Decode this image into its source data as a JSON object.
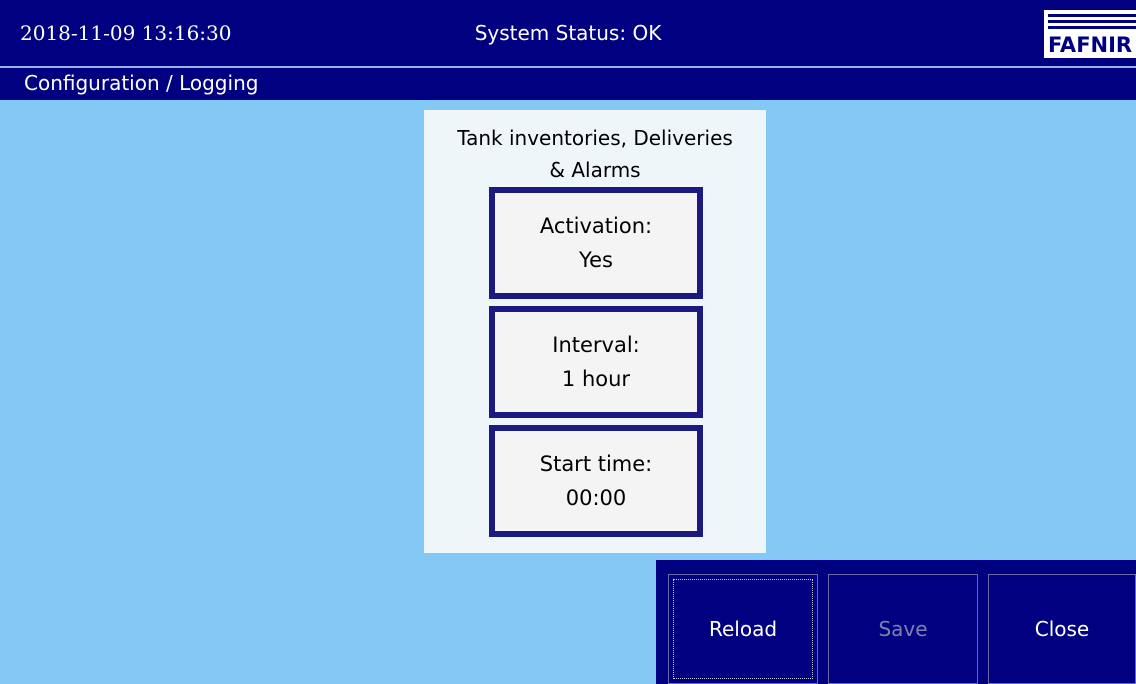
{
  "header": {
    "datetime": "2018-11-09 13:16:30",
    "status": "System Status: OK",
    "logo_text": "FAFNIR"
  },
  "breadcrumb": "Configuration / Logging",
  "panel": {
    "title_line1": "Tank inventories, Deliveries",
    "title_line2": "& Alarms",
    "fields": [
      {
        "label": "Activation:",
        "value": "Yes"
      },
      {
        "label": "Interval:",
        "value": "1 hour"
      },
      {
        "label": "Start time:",
        "value": "00:00"
      }
    ]
  },
  "actions": {
    "reload": "Reload",
    "save": "Save",
    "close": "Close"
  },
  "colors": {
    "background": "#84c8f5",
    "bar": "#000080",
    "panel": "#eef6fa",
    "button_border": "#1a1a80",
    "disabled_text": "#8080b0"
  }
}
